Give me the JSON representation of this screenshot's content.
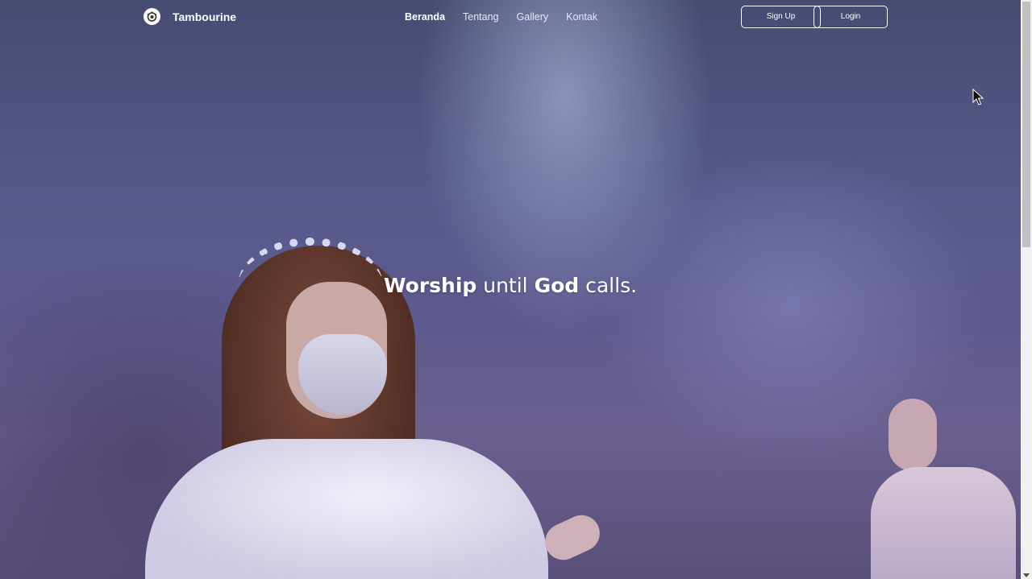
{
  "brand": {
    "name": "Tambourine",
    "logo_icon": "tambourine-logo-icon"
  },
  "nav": {
    "links": [
      {
        "label": "Beranda",
        "active": true
      },
      {
        "label": "Tentang",
        "active": false
      },
      {
        "label": "Gallery",
        "active": false
      },
      {
        "label": "Kontak",
        "active": false
      }
    ]
  },
  "auth": {
    "signup_label": "Sign Up",
    "login_label": "Login"
  },
  "hero": {
    "headline_parts": [
      {
        "text": "Worship",
        "bold": true
      },
      {
        "text": " until ",
        "bold": false
      },
      {
        "text": "God",
        "bold": true
      },
      {
        "text": " calls.",
        "bold": false
      }
    ]
  },
  "colors": {
    "hero_tint": "#575a8a",
    "text": "#ffffff",
    "scrollbar_track": "#f1f1f1",
    "scrollbar_thumb": "#c1c1c1"
  }
}
